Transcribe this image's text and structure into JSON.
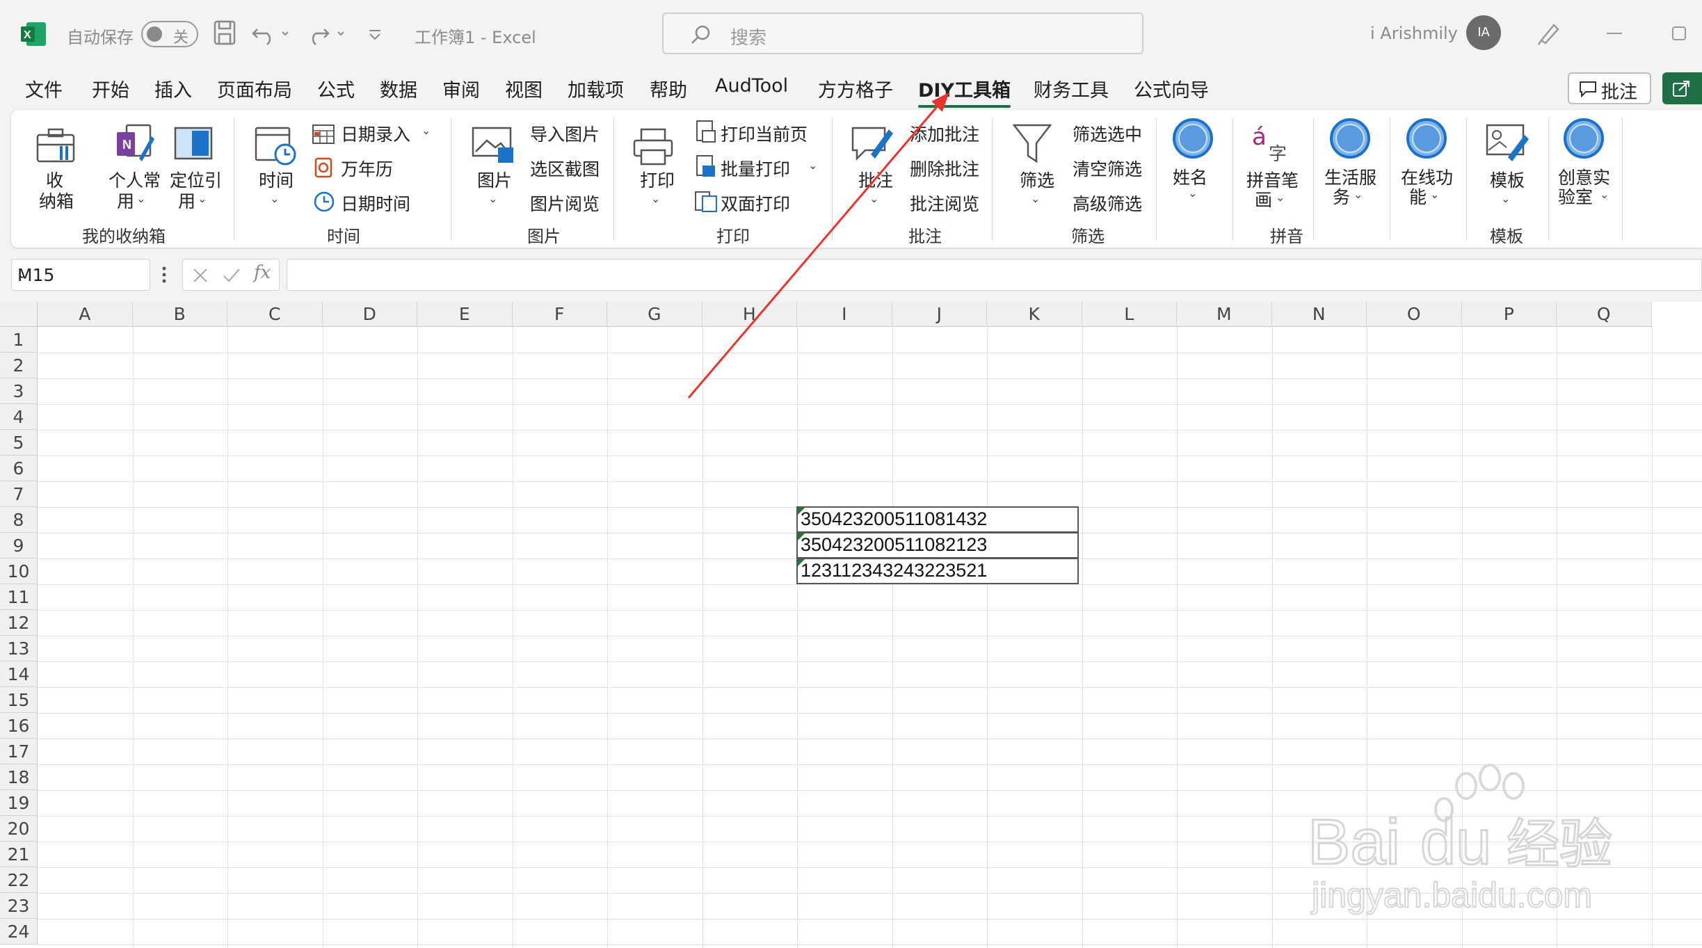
{
  "titlebar": {
    "autosave_label": "自动保存",
    "autosave_state": "关",
    "doc_title": "工作簿1  -  Excel",
    "search_placeholder": "搜索",
    "user_name": "i Arishmily",
    "avatar_initials": "IA"
  },
  "menu": [
    "文件",
    "开始",
    "插入",
    "页面布局",
    "公式",
    "数据",
    "审阅",
    "视图",
    "加载项",
    "帮助",
    "AudTool",
    "方方格子",
    "DIY工具箱",
    "财务工具",
    "公式向导"
  ],
  "active_tab": "DIY工具箱",
  "comment_button": "批注",
  "ribbon": {
    "storage": {
      "group": "我的收纳箱",
      "box_line1": "收",
      "box_line2": "纳箱",
      "personal_line1": "个人常",
      "personal_line2": "用",
      "locate_line1": "定位引",
      "locate_line2": "用"
    },
    "time": {
      "group": "时间",
      "big": "时间",
      "date_input": "日期录入",
      "calendar": "万年历",
      "datetime": "日期时间"
    },
    "picture": {
      "group": "图片",
      "big": "图片",
      "import": "导入图片",
      "capture": "选区截图",
      "browse": "图片阅览"
    },
    "print": {
      "group": "打印",
      "big": "打印",
      "current_page": "打印当前页",
      "batch": "批量打印",
      "duplex": "双面打印"
    },
    "comment": {
      "group": "批注",
      "big": "批注",
      "add": "添加批注",
      "delete": "删除批注",
      "browse": "批注阅览"
    },
    "filter": {
      "group": "筛选",
      "big": "筛选",
      "selected": "筛选选中",
      "clear": "清空筛选",
      "advanced": "高级筛选"
    },
    "name": {
      "big": "姓名"
    },
    "pinyin": {
      "group": "拼音",
      "line1": "拼音笔",
      "line2": "画"
    },
    "life": {
      "line1": "生活服",
      "line2": "务"
    },
    "online": {
      "line1": "在线功",
      "line2": "能"
    },
    "template": {
      "group": "模板",
      "big": "模板"
    },
    "lab": {
      "line1": "创意实",
      "line2": "验室"
    }
  },
  "formula_bar": {
    "name_box": "M15",
    "fx": "fx",
    "formula": ""
  },
  "columns": [
    "A",
    "B",
    "C",
    "D",
    "E",
    "F",
    "G",
    "H",
    "I",
    "J",
    "K",
    "L",
    "M",
    "N",
    "O",
    "P",
    "Q"
  ],
  "rows": [
    "1",
    "2",
    "3",
    "4",
    "5",
    "6",
    "7",
    "8",
    "9",
    "10",
    "11",
    "12",
    "13",
    "14",
    "15",
    "16",
    "17",
    "18",
    "19",
    "20",
    "21",
    "22",
    "23",
    "24"
  ],
  "cells": [
    {
      "ref": "I8",
      "value": "350423200511081432"
    },
    {
      "ref": "I9",
      "value": "350423200511082123"
    },
    {
      "ref": "I10",
      "value": "123112343243223521"
    }
  ],
  "watermark": {
    "brand": "Bai",
    "brand2": "du",
    "cn": "经验",
    "url": "jingyan.baidu.com"
  },
  "colors": {
    "excel_green": "#1f7145",
    "arrow_red": "#e8342c",
    "icon_blue": "#1a73c8"
  }
}
